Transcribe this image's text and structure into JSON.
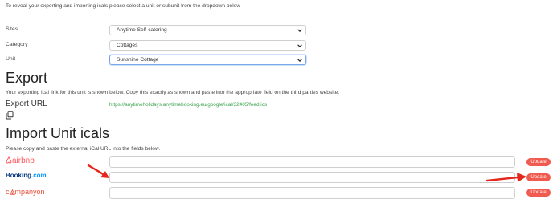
{
  "intro_text": "To reveal your exporting and importing icals please select a unit or subunit from the dropdown below",
  "filters": {
    "sites": {
      "label": "Sites",
      "value": "Anytime Self-catering"
    },
    "category": {
      "label": "Category",
      "value": "Cottages"
    },
    "unit": {
      "label": "Unit",
      "value": "Sunshine Cottage"
    }
  },
  "export": {
    "heading": "Export",
    "description": "Your exporting ical link for this unit is shown below. Copy this exactly as shown and paste into the appropriate field on the third parties website.",
    "url_label": "Export URL",
    "url": "https://anytimeholidays.anytimebooking.eu/google/ical/32405/feed.ics",
    "copy_icon": "copy-icon"
  },
  "import": {
    "heading": "Import Unit icals",
    "description": "Please copy and paste the external iCal URL into the fields below.",
    "rows": [
      {
        "provider": "airbnb",
        "input_value": "",
        "button": "Update"
      },
      {
        "provider_main": "Booking",
        "provider_suffix": ".com",
        "input_value": "",
        "button": "Update"
      },
      {
        "provider_c": "c",
        "provider_rest": "mpanyon",
        "input_value": "",
        "button": "Update"
      }
    ]
  },
  "colors": {
    "accent_red": "#f05a4f",
    "link_green": "#3aa14a",
    "airbnb": "#ff5a5f",
    "booking_blue": "#003580",
    "booking_light": "#0896ff",
    "campanyon": "#e8523a",
    "annotation_arrow": "#e3271c"
  }
}
